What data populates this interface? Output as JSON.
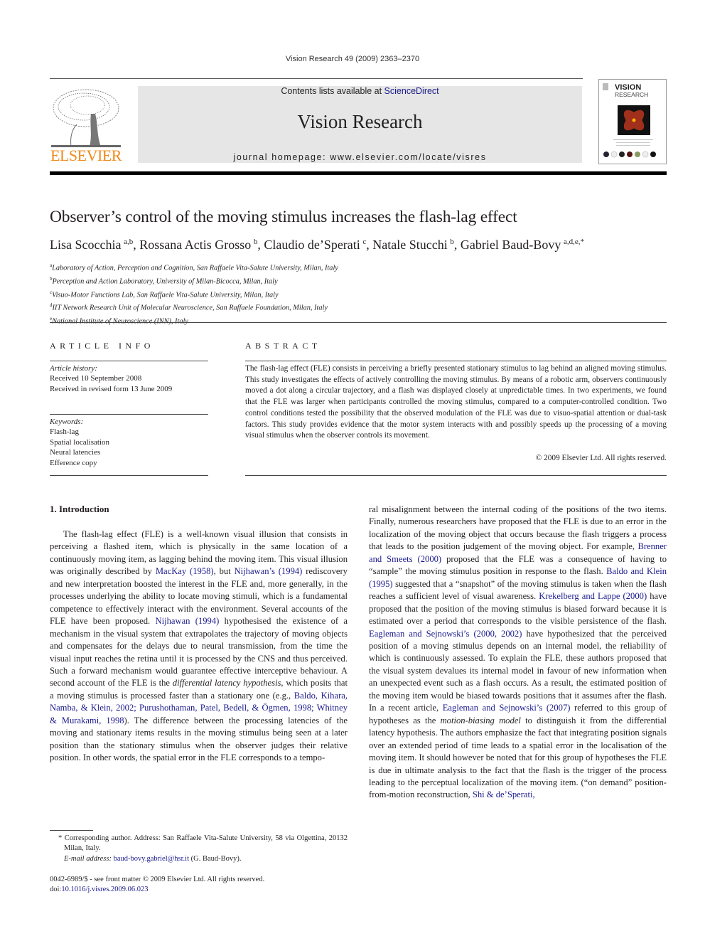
{
  "running_head": "Vision Research 49 (2009) 2363–2370",
  "header": {
    "publisher_logo_text": "ELSEVIER",
    "contents_prefix": "Contents lists available at ",
    "contents_link": "ScienceDirect",
    "journal_name": "Vision Research",
    "homepage_prefix": "journal homepage: ",
    "homepage_url": "www.elsevier.com/locate/visres",
    "cover": {
      "title_line1": "VISION",
      "title_line2": "RESEARCH"
    }
  },
  "article": {
    "title": "Observer’s control of the moving stimulus increases the flash-lag effect",
    "authors": [
      {
        "name": "Lisa Scocchia",
        "sup": "a,b"
      },
      {
        "name": "Rossana Actis Grosso",
        "sup": "b"
      },
      {
        "name": "Claudio de’Sperati",
        "sup": "c"
      },
      {
        "name": "Natale Stucchi",
        "sup": "b"
      },
      {
        "name": "Gabriel Baud-Bovy",
        "sup": "a,d,e,*"
      }
    ],
    "affiliations": [
      {
        "key": "a",
        "text": "Laboratory of Action, Perception and Cognition, San Raffaele Vita-Salute University, Milan, Italy"
      },
      {
        "key": "b",
        "text": "Perception and Action Laboratory, University of Milan-Bicocca, Milan, Italy"
      },
      {
        "key": "c",
        "text": "Visuo-Motor Functions Lab, San Raffaele Vita-Salute University, Milan, Italy"
      },
      {
        "key": "d",
        "text": "IIT Network Research Unit of Molecular Neuroscience, San Raffaele Foundation, Milan, Italy"
      },
      {
        "key": "e",
        "text": "National Institute of Neuroscience (INN), Italy"
      }
    ]
  },
  "article_info": {
    "heading": "ARTICLE INFO",
    "history_label": "Article history:",
    "history": [
      "Received 10 September 2008",
      "Received in revised form 13 June 2009"
    ],
    "keywords_label": "Keywords:",
    "keywords": [
      "Flash-lag",
      "Spatial localisation",
      "Neural latencies",
      "Efference copy"
    ]
  },
  "abstract": {
    "heading": "ABSTRACT",
    "text": "The flash-lag effect (FLE) consists in perceiving a briefly presented stationary stimulus to lag behind an aligned moving stimulus. This study investigates the effects of actively controlling the moving stimulus. By means of a robotic arm, observers continuously moved a dot along a circular trajectory, and a flash was displayed closely at unpredictable times. In two experiments, we found that the FLE was larger when participants controlled the moving stimulus, compared to a computer-controlled condition. Two control conditions tested the possibility that the observed modulation of the FLE was due to visuo-spatial attention or dual-task factors. This study provides evidence that the motor system interacts with and possibly speeds up the processing of a moving visual stimulus when the observer controls its movement.",
    "copyright": "© 2009 Elsevier Ltd. All rights reserved."
  },
  "body": {
    "section_heading": "1. Introduction",
    "left_segments": [
      {
        "t": "The flash-lag effect (FLE) is a well-known visual illusion that consists in perceiving a flashed item, which is physically in the same location of a continuously moving item, as lagging behind the moving item. This visual illusion was originally described by "
      },
      {
        "t": "MacKay (1958)",
        "link": true
      },
      {
        "t": ", but "
      },
      {
        "t": "Nijhawan’s (1994)",
        "link": true
      },
      {
        "t": " rediscovery and new interpretation boosted the interest in the FLE and, more generally, in the processes underlying the ability to locate moving stimuli, which is a fundamental competence to effectively interact with the environment. Several accounts of the FLE have been proposed. "
      },
      {
        "t": "Nijhawan (1994)",
        "link": true
      },
      {
        "t": " hypothesised the existence of a mechanism in the visual system that extrapolates the trajectory of moving objects and compensates for the delays due to neural transmission, from the time the visual input reaches the retina until it is processed by the CNS and thus perceived. Such a forward mechanism would guarantee effective interceptive behaviour. A second account of the FLE is the "
      },
      {
        "t": "differential latency hypothesis",
        "italic": true
      },
      {
        "t": ", which posits that a moving stimulus is processed faster than a stationary one (e.g., "
      },
      {
        "t": "Baldo, Kihara, Namba, & Klein, 2002; Purushothaman, Patel, Bedell, & Ögmen, 1998; Whitney & Murakami, 1998",
        "link": true
      },
      {
        "t": "). The difference between the processing latencies of the moving and stationary items results in the moving stimulus being seen at a later position than the stationary stimulus when the observer judges their relative position. In other words, the spatial error in the FLE corresponds to a tempo-"
      }
    ],
    "right_segments": [
      {
        "t": "ral misalignment between the internal coding of the positions of the two items. Finally, numerous researchers have proposed that the FLE is due to an error in the localization of the moving object that occurs because the flash triggers a process that leads to the position judgement of the moving object. For example, "
      },
      {
        "t": "Brenner and Smeets (2000)",
        "link": true
      },
      {
        "t": " proposed that the FLE was a consequence of having to “sample” the moving stimulus position in response to the flash. "
      },
      {
        "t": "Baldo and Klein (1995)",
        "link": true
      },
      {
        "t": " suggested that a “snapshot” of the moving stimulus is taken when the flash reaches a sufficient level of visual awareness. "
      },
      {
        "t": "Krekelberg and Lappe (2000)",
        "link": true
      },
      {
        "t": " have proposed that the position of the moving stimulus is biased forward because it is estimated over a period that corresponds to the visible persistence of the flash. "
      },
      {
        "t": "Eagleman and Sejnowski’s (2000, 2002)",
        "link": true
      },
      {
        "t": " have hypothesized that the perceived position of a moving stimulus depends on an internal model, the reliability of which is continuously assessed. To explain the FLE, these authors proposed that the visual system devalues its internal model in favour of new information when an unexpected event such as a flash occurs. As a result, the estimated position of the moving item would be biased towards positions that it assumes after the flash. In a recent article, "
      },
      {
        "t": "Eagleman and Sejnowski’s (2007)",
        "link": true
      },
      {
        "t": " referred to this group of hypotheses as the "
      },
      {
        "t": "motion-biasing model",
        "italic": true
      },
      {
        "t": " to distinguish it from the differential latency hypothesis. The authors emphasize the fact that integrating position signals over an extended period of time leads to a spatial error in the localisation of the moving item. It should however be noted that for this group of hypotheses the FLE is due in ultimate analysis to the fact that the flash is the trigger of the process leading to the perceptual localization of the moving item. (“on demand” position-from-motion reconstruction, "
      },
      {
        "t": "Shi & de’Sperati,",
        "link": true
      }
    ]
  },
  "footnote": {
    "corresponding": "* Corresponding author. Address: San Raffaele Vita-Salute University, 58 via Olgettina, 20132 Milan, Italy.",
    "email_label": "E-mail address: ",
    "email": "baud-bovy.gabriel@hsr.it",
    "email_suffix": " (G. Baud-Bovy).",
    "front_matter": "0042-6989/$ - see front matter © 2009 Elsevier Ltd. All rights reserved.",
    "doi_prefix": "doi:",
    "doi": "10.1016/j.visres.2009.06.023"
  },
  "colors": {
    "link": "#1a1a8c",
    "elsevier_orange": "#f08a1c",
    "band_gray": "#e6e6e6"
  }
}
